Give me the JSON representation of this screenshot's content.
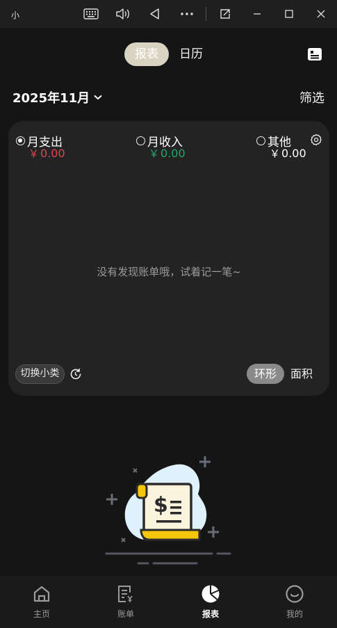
{
  "window": {
    "title": "小"
  },
  "titlebar_icons": [
    "keyboard-icon",
    "volume-icon",
    "back-triangle-icon",
    "more-icon",
    "pip-icon",
    "minimize-icon",
    "maximize-icon",
    "close-icon"
  ],
  "tabs": [
    {
      "label": "报表",
      "active": true
    },
    {
      "label": "日历",
      "active": false
    }
  ],
  "header": {
    "month": "2025年11月",
    "filter_label": "筛选"
  },
  "card": {
    "options": [
      {
        "label": "月支出",
        "amount": "0.00",
        "currency": "￥",
        "checked": true,
        "color": "#e0434e"
      },
      {
        "label": "月收入",
        "amount": "0.00",
        "currency": "￥",
        "checked": false,
        "color": "#1fa86a"
      },
      {
        "label": "其他",
        "amount": "0.00",
        "currency": "￥",
        "checked": false,
        "color": "#ffffff"
      }
    ],
    "empty_message": "没有发现账单哦，试着记一笔~",
    "switch_label": "切换小类",
    "chart_types": [
      "环形",
      "面积"
    ]
  },
  "nav": [
    {
      "label": "主页",
      "icon": "home-icon",
      "active": false
    },
    {
      "label": "账单",
      "icon": "bill-icon",
      "active": false
    },
    {
      "label": "报表",
      "icon": "pie-chart-icon",
      "active": true
    },
    {
      "label": "我的",
      "icon": "smile-icon",
      "active": false
    }
  ],
  "colors": {
    "background": "#151515",
    "card": "#232323",
    "expense": "#e0434e",
    "income": "#1fa86a",
    "tab_active": "#d9d3c2",
    "illustration_yellow": "#f5c60a",
    "illustration_blue": "#dff1fb"
  }
}
